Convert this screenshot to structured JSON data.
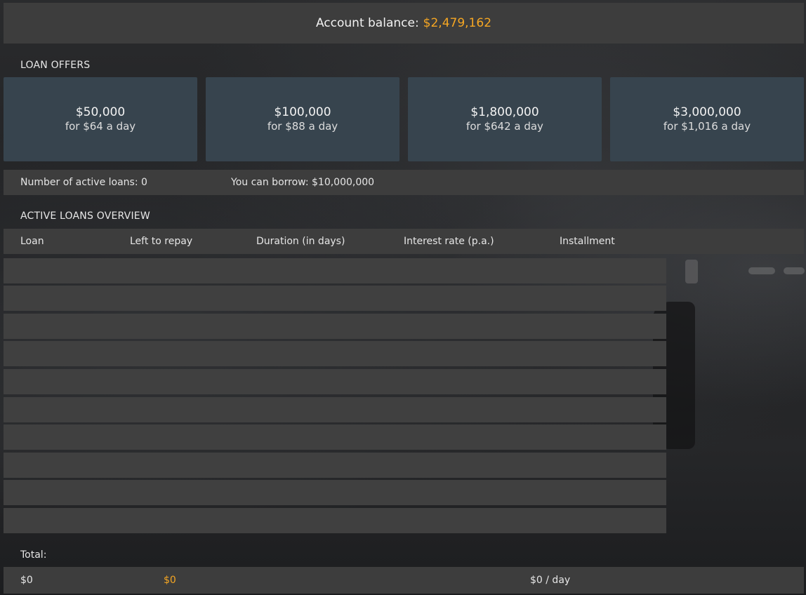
{
  "balance": {
    "label": "Account balance:",
    "value": "$2,479,162"
  },
  "loan_offers": {
    "title": "LOAN OFFERS",
    "items": [
      {
        "amount": "$50,000",
        "rate": "for $64 a day"
      },
      {
        "amount": "$100,000",
        "rate": "for $88 a day"
      },
      {
        "amount": "$1,800,000",
        "rate": "for $642 a day"
      },
      {
        "amount": "$3,000,000",
        "rate": "for $1,016 a day"
      }
    ]
  },
  "info": {
    "active_loans": "Number of active loans: 0",
    "can_borrow": "You can borrow: $10,000,000"
  },
  "overview": {
    "title": "ACTIVE LOANS OVERVIEW",
    "columns": [
      "Loan",
      "Left to repay",
      "Duration (in days)",
      "Interest rate (p.a.)",
      "Installment"
    ],
    "rows": [
      [],
      [],
      [],
      [],
      [],
      [],
      [],
      [],
      [],
      []
    ]
  },
  "totals": {
    "label": "Total:",
    "loan": "$0",
    "left_to_repay": "$0",
    "installment": "$0 / day"
  },
  "colors": {
    "accent": "#f5a623",
    "offer_bg": "#37444e",
    "bar_bg": "#3d3d3d"
  }
}
